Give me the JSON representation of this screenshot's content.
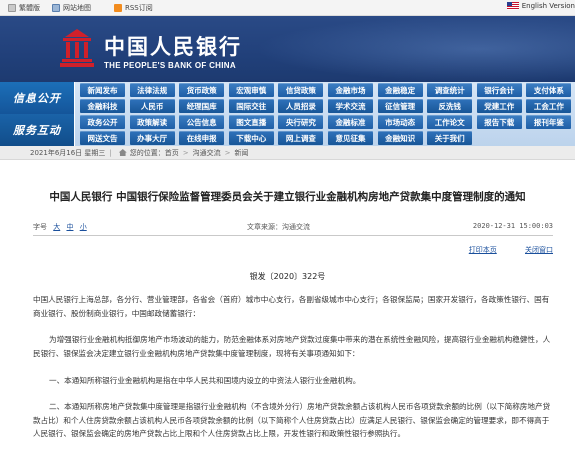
{
  "topbar": {
    "traditional": "繁體版",
    "sitemap": "网站地图",
    "rss": "RSS订阅",
    "english": "English Version"
  },
  "banner": {
    "cn_name": "中国人民银行",
    "en_name": "THE PEOPLE'S BANK OF CHINA"
  },
  "nav": {
    "section1": "信息公开",
    "section2": "服务互动",
    "rows": [
      [
        "新闻发布",
        "法律法规",
        "货币政策",
        "宏观审慎",
        "信贷政策",
        "金融市场",
        "金融稳定",
        "调查统计",
        "银行会计",
        "支付体系"
      ],
      [
        "金融科技",
        "人民币",
        "经理国库",
        "国际交往",
        "人员招录",
        "学术交流",
        "征信管理",
        "反洗钱",
        "党建工作",
        "工会工作"
      ],
      [
        "政务公开",
        "政策解读",
        "公告信息",
        "图文直播",
        "央行研究",
        "金融标准",
        "市场动态",
        "工作论文",
        "报告下载",
        "报刊年鉴"
      ],
      [
        "网送文告",
        "办事大厅",
        "在线申报",
        "下载中心",
        "网上调查",
        "意见征集",
        "金融知识",
        "关于我们"
      ]
    ]
  },
  "breadcrumb": {
    "date": "2021年6月16日 星期三",
    "you_are_here": "您的位置：",
    "items": [
      "首页",
      "沟通交流",
      "新闻"
    ]
  },
  "article": {
    "title": "中国人民银行  中国银行保险监督管理委员会关于建立银行业金融机构房地产贷款集中度管理制度的通知",
    "font_size_label": "字号",
    "font_sizes": [
      "大",
      "中",
      "小"
    ],
    "source": "文章来源：沟通交流",
    "date": "2020-12-31 15:00:03",
    "print": "打印本页",
    "close": "关闭窗口",
    "doc_no": "银发〔2020〕322号",
    "paragraphs": [
      "中国人民银行上海总部，各分行、营业管理部，各省会（首府）城市中心支行，各副省级城市中心支行；各银保监局；国家开发银行，各政策性银行、国有商业银行、股份制商业银行，中国邮政储蓄银行：",
      "为增强银行业金融机构抵御房地产市场波动的能力，防范金融体系对房地产贷款过度集中带来的潜在系统性金融风险，提高银行业金融机构稳健性，人民银行、银保监会决定建立银行业金融机构房地产贷款集中度管理制度，现将有关事项通知如下：",
      "一、本通知所称银行业金融机构是指在中华人民共和国境内设立的中资法人银行业金融机构。",
      "二、本通知所称房地产贷款集中度管理是指银行业金融机构（不含境外分行）房地产贷款余额占该机构人民币各项贷款余额的比例（以下简称房地产贷款占比）和个人住房贷款余额占该机构人民币各项贷款余额的比例（以下简称个人住房贷款占比）应满足人民银行、银保监会确定的管理要求，即不得高于人民银行、银保监会确定的房地产贷款占比上限和个人住房贷款占比上限，开发性银行和政策性银行参照执行。"
    ]
  }
}
